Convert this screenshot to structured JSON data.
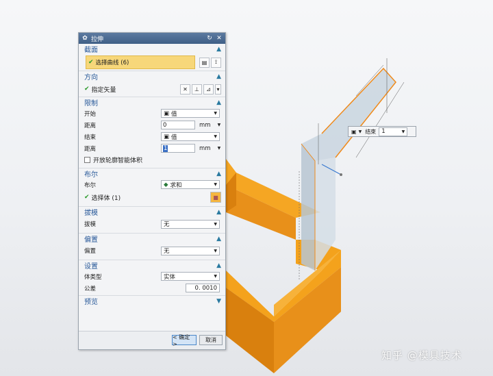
{
  "dialog": {
    "title": "拉伸",
    "sections": {
      "section": {
        "label": "截面",
        "select_curve": "选择曲线 (6)"
      },
      "direction": {
        "label": "方向",
        "specify_vector": "指定矢量"
      },
      "limits": {
        "label": "限制",
        "start_label": "开始",
        "start_value": "值",
        "distance1_label": "距离",
        "distance1_value": "0",
        "distance1_unit": "mm",
        "end_label": "结束",
        "end_value": "值",
        "distance2_label": "距离",
        "distance2_value": "1",
        "distance2_unit": "mm",
        "open_profile": "开放轮廓智能体积"
      },
      "boolean": {
        "label": "布尔",
        "boolean_label": "布尔",
        "boolean_value": "求和",
        "select_body": "选择体 (1)"
      },
      "draft": {
        "label": "拔模",
        "draft_label": "拔模",
        "draft_value": "无"
      },
      "offset": {
        "label": "偏置",
        "offset_label": "偏置",
        "offset_value": "无"
      },
      "settings": {
        "label": "设置",
        "body_type_label": "体类型",
        "body_type_value": "实体",
        "tolerance_label": "公差",
        "tolerance_value": "0. 0010"
      },
      "preview": {
        "label": "预览"
      }
    },
    "ok_label": "< 确定 >",
    "cancel_label": "取消"
  },
  "floating_toolbar": {
    "end_label": "结束",
    "end_value": "1"
  },
  "watermark": "知乎 @模具技术",
  "colors": {
    "solid": "#f4a21c",
    "preview": "#b9c9d6",
    "title_bar": "#4a6a93",
    "highlight": "#f7d77a"
  }
}
